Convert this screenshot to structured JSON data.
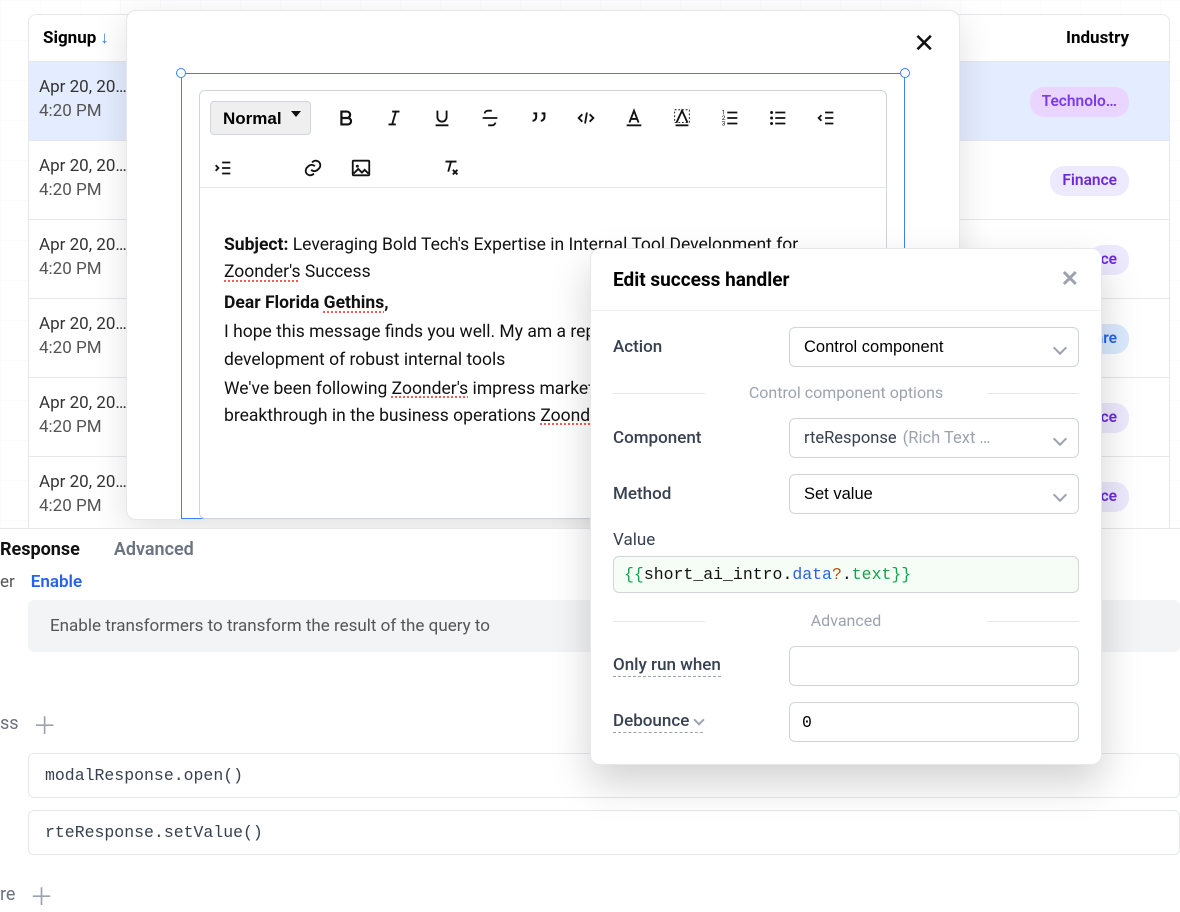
{
  "table": {
    "header_signup": "Signup",
    "header_industry": "Industry",
    "rows": [
      {
        "date": "Apr 20, 20…",
        "time": "4:20 PM",
        "badge": "Technolo…",
        "badge_cls": "tech",
        "selected": true
      },
      {
        "date": "Apr 20, 20…",
        "time": "4:20 PM",
        "badge": "Finance",
        "badge_cls": "fin"
      },
      {
        "date": "Apr 20, 20…",
        "time": "4:20 PM",
        "badge": "ce",
        "badge_cls": "ce"
      },
      {
        "date": "Apr 20, 20…",
        "time": "4:20 PM",
        "badge": "care",
        "badge_cls": "hc"
      },
      {
        "date": "Apr 20, 20…",
        "time": "4:20 PM",
        "badge": "ce",
        "badge_cls": "ce"
      },
      {
        "date": "Apr 20, 20…",
        "time": "4:20 PM",
        "badge": "ce",
        "badge_cls": "ce"
      }
    ]
  },
  "rte": {
    "heading_select": "Normal",
    "subject_label": "Subject:",
    "subject_text": "Leveraging Bold Tech's Expertise in Internal Tool Development for Zoonder's Success",
    "dear": "Dear Florida Gethins,",
    "p1": " I hope this message finds you well. My am a representative from Bold Tech, an the development of robust internal tools",
    "p2": " We've been following Zoonder's impress market positioning in the industry. Your i breakthrough in the business operations Zoonder's success has caught our atten"
  },
  "lower": {
    "tabs": [
      "Response",
      "Advanced"
    ],
    "er_label": "er",
    "enable_label": "Enable",
    "enable_desc": "Enable transformers to transform the result of the query to",
    "ss_label": "ss",
    "re_label": "re",
    "handlers": [
      "modalResponse.open()",
      "rteResponse.setValue()"
    ]
  },
  "popup": {
    "title": "Edit success handler",
    "action_k": "Action",
    "action_v": "Control component",
    "divider1": "Control component options",
    "component_k": "Component",
    "component_v_a": "rteResponse",
    "component_v_b": "(Rich Text …",
    "method_k": "Method",
    "method_v": "Set value",
    "value_k": "Value",
    "value_code": "{{short_ai_intro.data?.text}}",
    "divider2": "Advanced",
    "only_run_k": "Only run when",
    "only_run_v": "",
    "debounce_k": "Debounce",
    "debounce_v": "0"
  }
}
